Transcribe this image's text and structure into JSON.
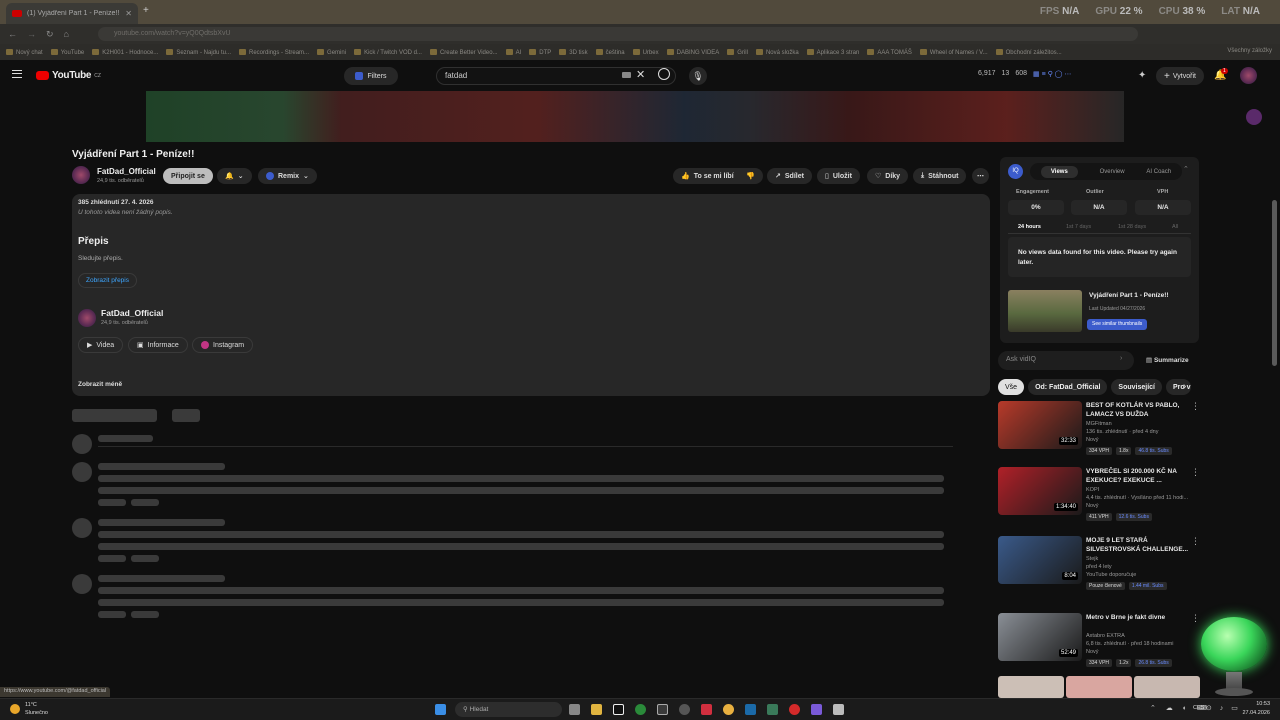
{
  "browser": {
    "tab_title": "(1) Vyjádření Part 1 - Peníze!!",
    "url": "youtube.com/watch?v=yQ0QdtsbXvU",
    "perf": {
      "fps_label": "FPS",
      "fps": "N/A",
      "gpu_label": "GPU",
      "gpu": "22 %",
      "cpu_label": "CPU",
      "cpu": "38 %",
      "lat_label": "LAT",
      "lat": "N/A"
    },
    "bookmarks": [
      "Nový chat",
      "YouTube",
      "K2H001 - Hodnoce...",
      "Seznam - Najdu tu...",
      "Recordings - Stream...",
      "Gemini",
      "Kick / Twitch VOD d...",
      "Create Better Video...",
      "AI",
      "DTP",
      "3D tisk",
      "čeština",
      "Urbex",
      "DABING VIDEA",
      "Grill",
      "Nová složka",
      "Aplikace 3 stran",
      "AAA TOMÁŠ",
      "Wheel of Names / V...",
      "Obchodní záležitos..."
    ],
    "all_bookmarks": "Všechny záložky"
  },
  "header": {
    "logo": "YouTube",
    "country": "CZ",
    "filters": "Filters",
    "search_value": "fatdad",
    "stats": [
      "6,917",
      "13",
      "608"
    ],
    "create": "Vytvořit",
    "notif_count": "1"
  },
  "video": {
    "title": "Vyjádření Part 1 - Peníze!!",
    "channel": "FatDad_Official",
    "subs": "24,9 tis. odběratelů",
    "join": "Připojit se",
    "remix": "Remix",
    "like": "To se mi líbí",
    "share": "Sdílet",
    "save": "Uložit",
    "thanks": "Díky",
    "download": "Stáhnout"
  },
  "description": {
    "meta": "385 zhlédnutí  27. 4. 2026",
    "no_desc": "U tohoto videa není žádný popis.",
    "transcript_h": "Přepis",
    "transcript_sub": "Sledujte přepis.",
    "show_transcript": "Zobrazit přepis",
    "channel": "FatDad_Official",
    "subs": "24,9 tis. odběratelů",
    "videos": "Videa",
    "info": "Informace",
    "instagram": "Instagram",
    "show_less": "Zobrazit méně"
  },
  "vidiq": {
    "tabs": [
      "Views",
      "Overview",
      "AI Coach"
    ],
    "metrics": [
      {
        "label": "Engagement",
        "value": "0%"
      },
      {
        "label": "Outlier",
        "value": "N/A"
      },
      {
        "label": "VPH",
        "value": "N/A"
      }
    ],
    "ranges": [
      "24 hours",
      "1st 7 days",
      "1st 28 days",
      "All"
    ],
    "no_data": "No views data found for this video. Please try again later.",
    "card_title": "Vyjádření Part 1 - Peníze!!",
    "card_updated": "Last Updated 04/27/2026",
    "card_btn": "See similar thumbnails",
    "ask_placeholder": "Ask vidIQ",
    "summarize": "Summarize"
  },
  "chips": [
    "Vše",
    "Od: FatDad_Official",
    "Související",
    "Pro v"
  ],
  "recs": [
    {
      "title": "BEST OF KOTLÁR VS PABLO, LAMACZ VS DUŽDA",
      "channel": "MGFitman",
      "meta": "136 tis. zhlédnutí · před 4 dny",
      "new": "Nový",
      "duration": "32:33",
      "b1": "334 VPH",
      "b2": "1.8x",
      "b3": "46.8 tis. Subs",
      "thumb": "#b83a2a"
    },
    {
      "title": "VYBREČEL SI 200.000 KČ NA EXEKUCE? EXEKUCE ...",
      "channel": "KOPI",
      "meta": "4,4 tis. zhlédnutí · Vysíláno před 11 hodi...",
      "new": "Nový",
      "duration": "1:34:40",
      "b1": "411 VPH",
      "b2": "",
      "b3": "12.6 tis. Subs",
      "thumb": "#b02028"
    },
    {
      "title": "MOJE 9 LET STARÁ SILVESTROVSKÁ CHALLENGE...",
      "channel": "Stejk",
      "meta": "před 4 lety",
      "new": "YouTube doporučuje",
      "duration": "8:04",
      "b1": "Pouze členové",
      "b2": "",
      "b3": "1.44 mil. Subs",
      "thumb": "#3a5a8a"
    },
    {
      "title": "Metro v Brne je fakt divne",
      "channel": "Axtabro EXTRA",
      "meta": "6,8 tis. zhlédnutí · před 18 hodinami",
      "new": "Nový",
      "duration": "52:49",
      "b1": "334 VPH",
      "b2": "1.2x",
      "b3": "26.8 tis. Subs",
      "thumb": "#8a8f96"
    }
  ],
  "status_url": "https://www.youtube.com/@fatdad_official",
  "taskbar": {
    "weather_temp": "11°C",
    "weather_desc": "Slunečno",
    "search": "Hledat",
    "lang": "CES",
    "time": "10:53",
    "date": "27.04.2026"
  }
}
